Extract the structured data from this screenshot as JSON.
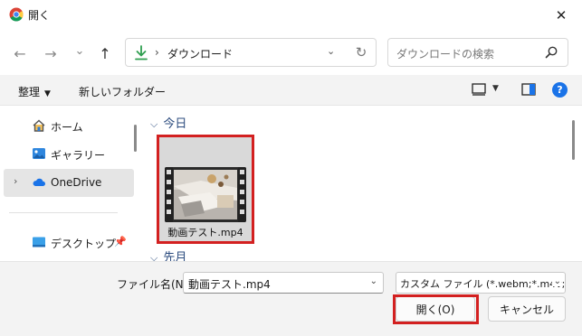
{
  "window": {
    "title": "開く",
    "close_glyph": "✕"
  },
  "nav": {
    "back_glyph": "←",
    "forward_glyph": "→",
    "history_glyph": "⌄",
    "up_glyph": "↑",
    "path_separator": "›",
    "path": "ダウンロード",
    "dropdown_glyph": "⌄",
    "refresh_glyph": "↻",
    "search_placeholder": "ダウンロードの検索"
  },
  "toolbar": {
    "organize_label": "整理",
    "caret_glyph": "▼",
    "new_folder_label": "新しいフォルダー",
    "help_glyph": "?"
  },
  "sidebar": {
    "items": [
      {
        "label": "ホーム",
        "icon": "home-icon"
      },
      {
        "label": "ギャラリー",
        "icon": "gallery-icon"
      },
      {
        "label": "OneDrive",
        "icon": "cloud-icon",
        "selected": true,
        "expander": "›"
      },
      {
        "label": "デスクトップ",
        "icon": "desktop-icon",
        "pinned": true
      }
    ]
  },
  "main": {
    "groups": [
      {
        "label": "今日",
        "chevron": "⌵"
      },
      {
        "label": "先月",
        "chevron": "⌵"
      }
    ],
    "files": [
      {
        "name": "動画テスト.mp4",
        "type": "video",
        "highlighted": true
      }
    ]
  },
  "footer": {
    "filename_label": "ファイル名(N):",
    "filename_value": "動画テスト.mp4",
    "filetype_value": "カスタム ファイル (*.webm;*.m4v;*.",
    "dropdown_glyph": "⌄",
    "open_label": "開く(O)",
    "cancel_label": "キャンセル"
  },
  "colors": {
    "highlight": "#d32020",
    "toolbar_bg": "#f3f3f3",
    "selected_bg": "#e5e5e5",
    "group_header": "#2b4b7e",
    "download_green": "#2e9e4f",
    "onedrive_blue": "#1a73e8"
  }
}
